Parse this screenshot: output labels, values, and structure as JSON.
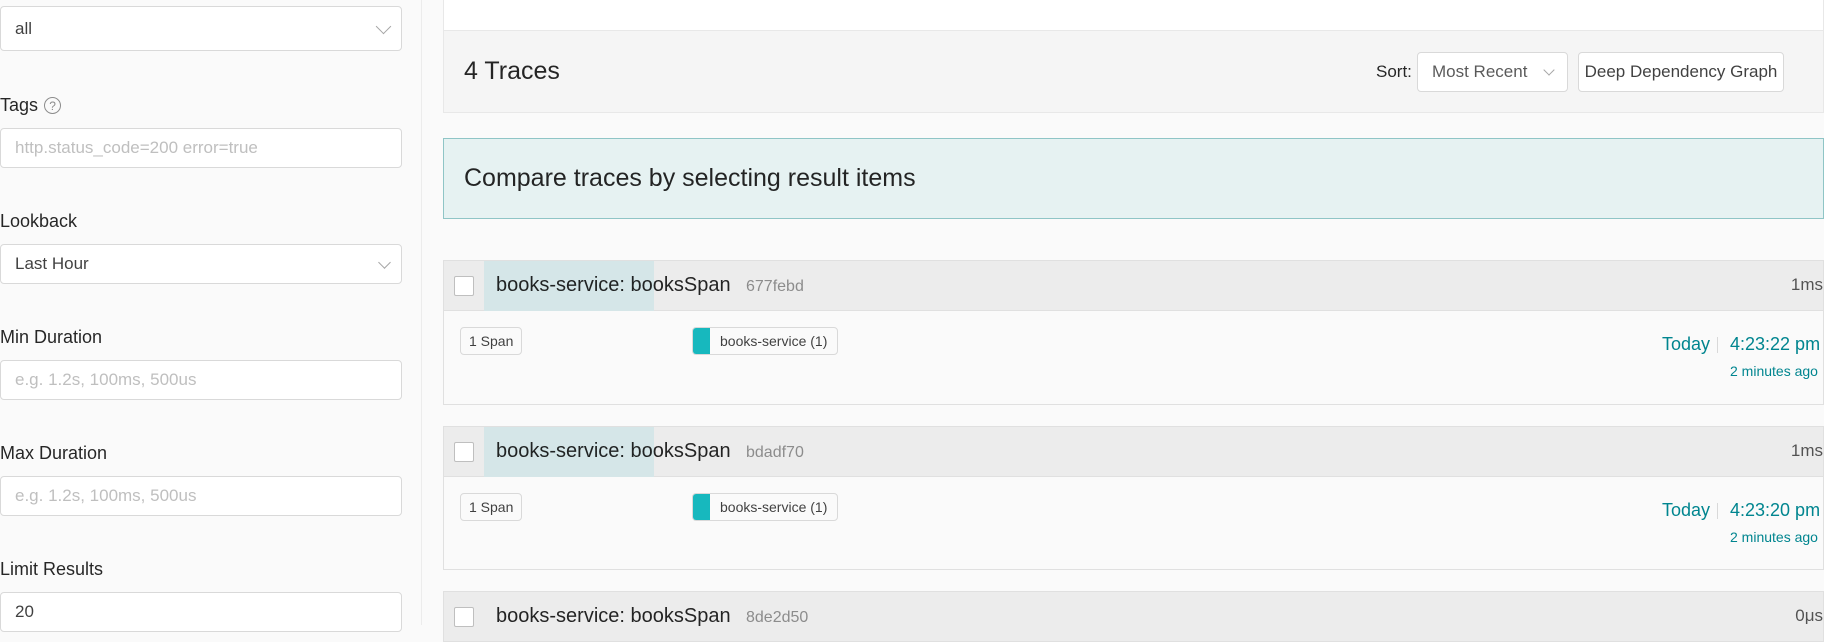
{
  "sidebar": {
    "operation_value": "all",
    "tags_label": "Tags",
    "tags_help": "?",
    "tags_placeholder": "http.status_code=200 error=true",
    "lookback_label": "Lookback",
    "lookback_value": "Last Hour",
    "min_duration_label": "Min Duration",
    "min_duration_placeholder": "e.g. 1.2s, 100ms, 500us",
    "max_duration_label": "Max Duration",
    "max_duration_placeholder": "e.g. 1.2s, 100ms, 500us",
    "limit_label": "Limit Results",
    "limit_value": "20"
  },
  "header": {
    "traces_count": "4 Traces",
    "sort_label": "Sort:",
    "sort_value": "Most Recent",
    "ddg_button": "Deep Dependency Graph"
  },
  "compare_banner": "Compare traces by selecting result items",
  "traces": [
    {
      "title": "books-service: booksSpan",
      "id": "677febd",
      "duration": "1ms",
      "spans": "1 Span",
      "service": "books-service (1)",
      "service_color": "#17b8be",
      "date": "Today",
      "time": "4:23:22 pm",
      "ago": "2 minutes ago"
    },
    {
      "title": "books-service: booksSpan",
      "id": "bdadf70",
      "duration": "1ms",
      "spans": "1 Span",
      "service": "books-service (1)",
      "service_color": "#17b8be",
      "date": "Today",
      "time": "4:23:20 pm",
      "ago": "2 minutes ago"
    },
    {
      "title": "books-service: booksSpan",
      "id": "8de2d50",
      "duration": "0μs"
    }
  ]
}
